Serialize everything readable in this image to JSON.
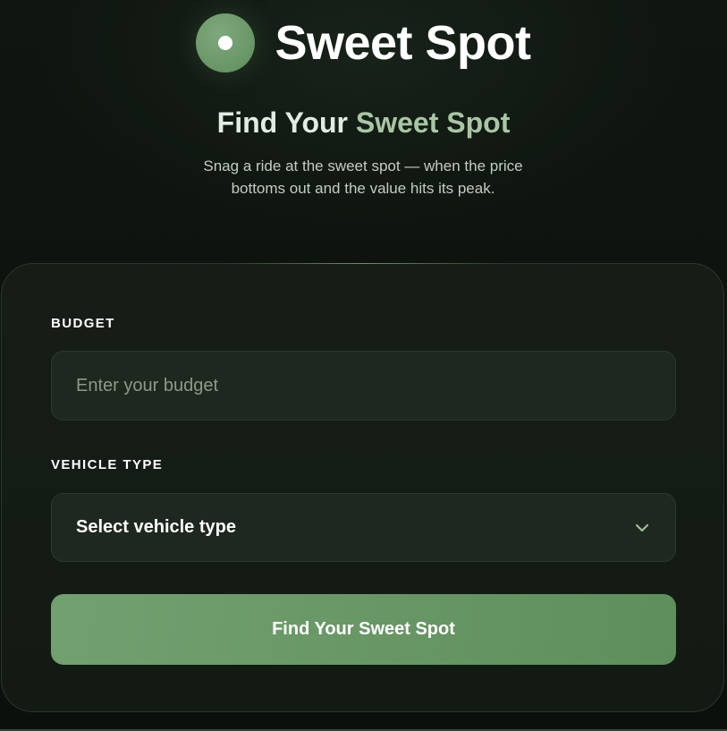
{
  "brand": {
    "name": "Sweet Spot",
    "logo_icon": "target-dot-icon"
  },
  "hero": {
    "headline_part1": "Find Your",
    "headline_part2": "Sweet Spot",
    "subtitle": "Snag a ride at the sweet spot — when the price bottoms out and the value hits its peak."
  },
  "form": {
    "budget_label": "BUDGET",
    "budget_placeholder": "Enter your budget",
    "budget_value": "",
    "vehicle_label": "VEHICLE TYPE",
    "vehicle_selected": "Select vehicle type",
    "vehicle_icon": "chevron-down-icon",
    "submit_label": "Find Your Sweet Spot"
  },
  "colors": {
    "background": "#0c110d",
    "card": "#161d17",
    "accent": "#6a9a67",
    "headline_accent": "#a9c6a4"
  }
}
